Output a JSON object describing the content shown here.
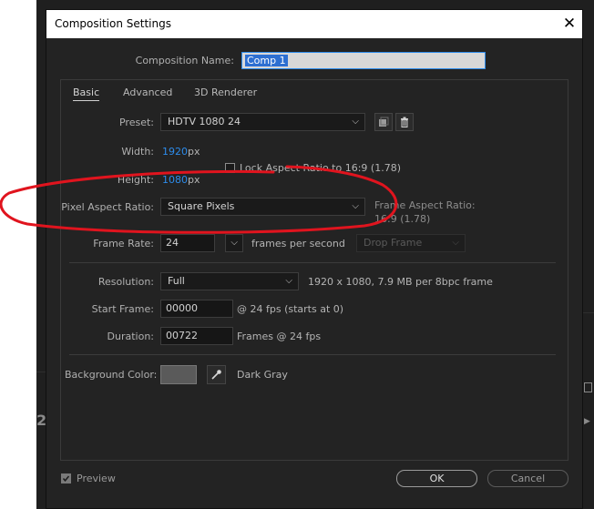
{
  "dialog": {
    "title": "Composition Settings",
    "close_glyph": "✕"
  },
  "comp_name": {
    "label": "Composition Name:",
    "value": "Comp 1"
  },
  "tabs": [
    {
      "label": "Basic",
      "active": true
    },
    {
      "label": "Advanced",
      "active": false
    },
    {
      "label": "3D Renderer",
      "active": false
    }
  ],
  "preset": {
    "label": "Preset:",
    "value": "HDTV 1080 24"
  },
  "width": {
    "label": "Width:",
    "value": "1920",
    "unit": "px"
  },
  "height": {
    "label": "Height:",
    "value": "1080",
    "unit": "px"
  },
  "lock_aspect": {
    "label": "Lock Aspect Ratio to 16:9 (1.78)",
    "checked": false
  },
  "pixel_aspect": {
    "label": "Pixel Aspect Ratio:",
    "value": "Square Pixels"
  },
  "frame_aspect": {
    "label": "Frame Aspect Ratio:",
    "value": "16:9 (1.78)"
  },
  "frame_rate": {
    "label": "Frame Rate:",
    "value": "24",
    "unit": "frames per second",
    "drop_frame": "Drop Frame"
  },
  "resolution": {
    "label": "Resolution:",
    "value": "Full",
    "info": "1920 x 1080, 7.9 MB per 8bpc frame"
  },
  "start_frame": {
    "label": "Start Frame:",
    "value": "00000",
    "info": "@ 24 fps (starts at 0)"
  },
  "duration": {
    "label": "Duration:",
    "value": "00722",
    "info": "Frames @ 24 fps"
  },
  "background": {
    "label": "Background Color:",
    "name": "Dark Gray",
    "color": "#5a5a5a"
  },
  "preview": {
    "label": "Preview",
    "checked": true
  },
  "buttons": {
    "ok": "OK",
    "cancel": "Cancel"
  },
  "background_app": {
    "left_mark": "2"
  },
  "annotation": {
    "color": "#e0141e"
  }
}
